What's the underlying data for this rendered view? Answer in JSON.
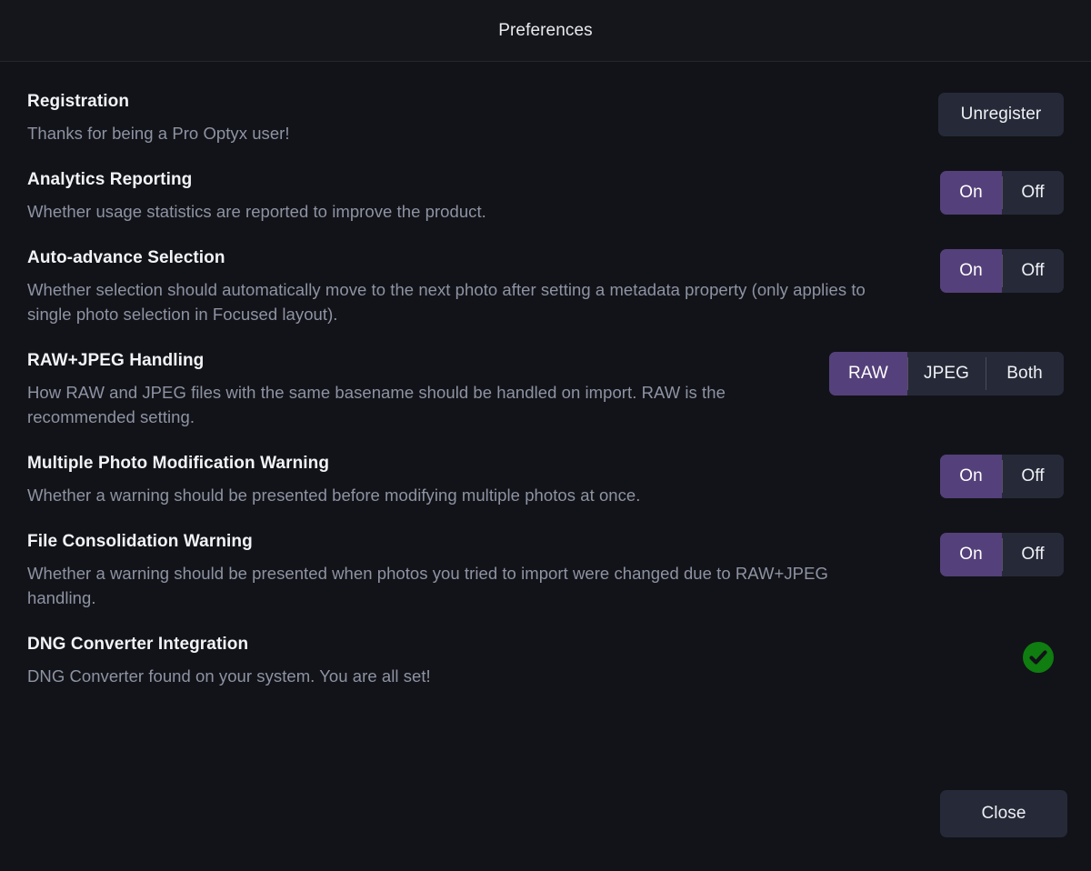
{
  "window": {
    "title": "Preferences"
  },
  "settings": [
    {
      "key": "registration",
      "title": "Registration",
      "description": "Thanks for being a Pro Optyx user!",
      "control": "button",
      "button_label": "Unregister"
    },
    {
      "key": "analytics-reporting",
      "title": "Analytics Reporting",
      "description": "Whether usage statistics are reported to improve the product.",
      "control": "segmented",
      "options": [
        "On",
        "Off"
      ],
      "selected": "On"
    },
    {
      "key": "auto-advance-selection",
      "title": "Auto-advance Selection",
      "description": "Whether selection should automatically move to the next photo after setting a metadata property (only applies to single photo selection in Focused layout).",
      "control": "segmented",
      "options": [
        "On",
        "Off"
      ],
      "selected": "On"
    },
    {
      "key": "raw-jpeg-handling",
      "title": "RAW+JPEG Handling",
      "description": "How RAW and JPEG files with the same basename should be handled on import. RAW is the recommended setting.",
      "control": "segmented",
      "options": [
        "RAW",
        "JPEG",
        "Both"
      ],
      "selected": "RAW"
    },
    {
      "key": "multiple-photo-modification-warning",
      "title": "Multiple Photo Modification Warning",
      "description": "Whether a warning should be presented before modifying multiple photos at once.",
      "control": "segmented",
      "options": [
        "On",
        "Off"
      ],
      "selected": "On"
    },
    {
      "key": "file-consolidation-warning",
      "title": "File Consolidation Warning",
      "description": "Whether a warning should be presented when photos you tried to import were changed due to RAW+JPEG handling.",
      "control": "segmented",
      "options": [
        "On",
        "Off"
      ],
      "selected": "On"
    },
    {
      "key": "dng-converter-integration",
      "title": "DNG Converter Integration",
      "description": "DNG Converter found on your system. You are all set!",
      "control": "status",
      "status_icon": "check-circle-icon",
      "status_color": "#0f7d10"
    }
  ],
  "footer": {
    "close_label": "Close"
  },
  "colors": {
    "window_background": "#121318",
    "titlebar_background": "#15161b",
    "accent_selected": "#54407a",
    "control_background": "#262a38",
    "title_text": "#f2f3f6",
    "description_text": "#8e93a3",
    "success_green": "#0f7d10"
  }
}
